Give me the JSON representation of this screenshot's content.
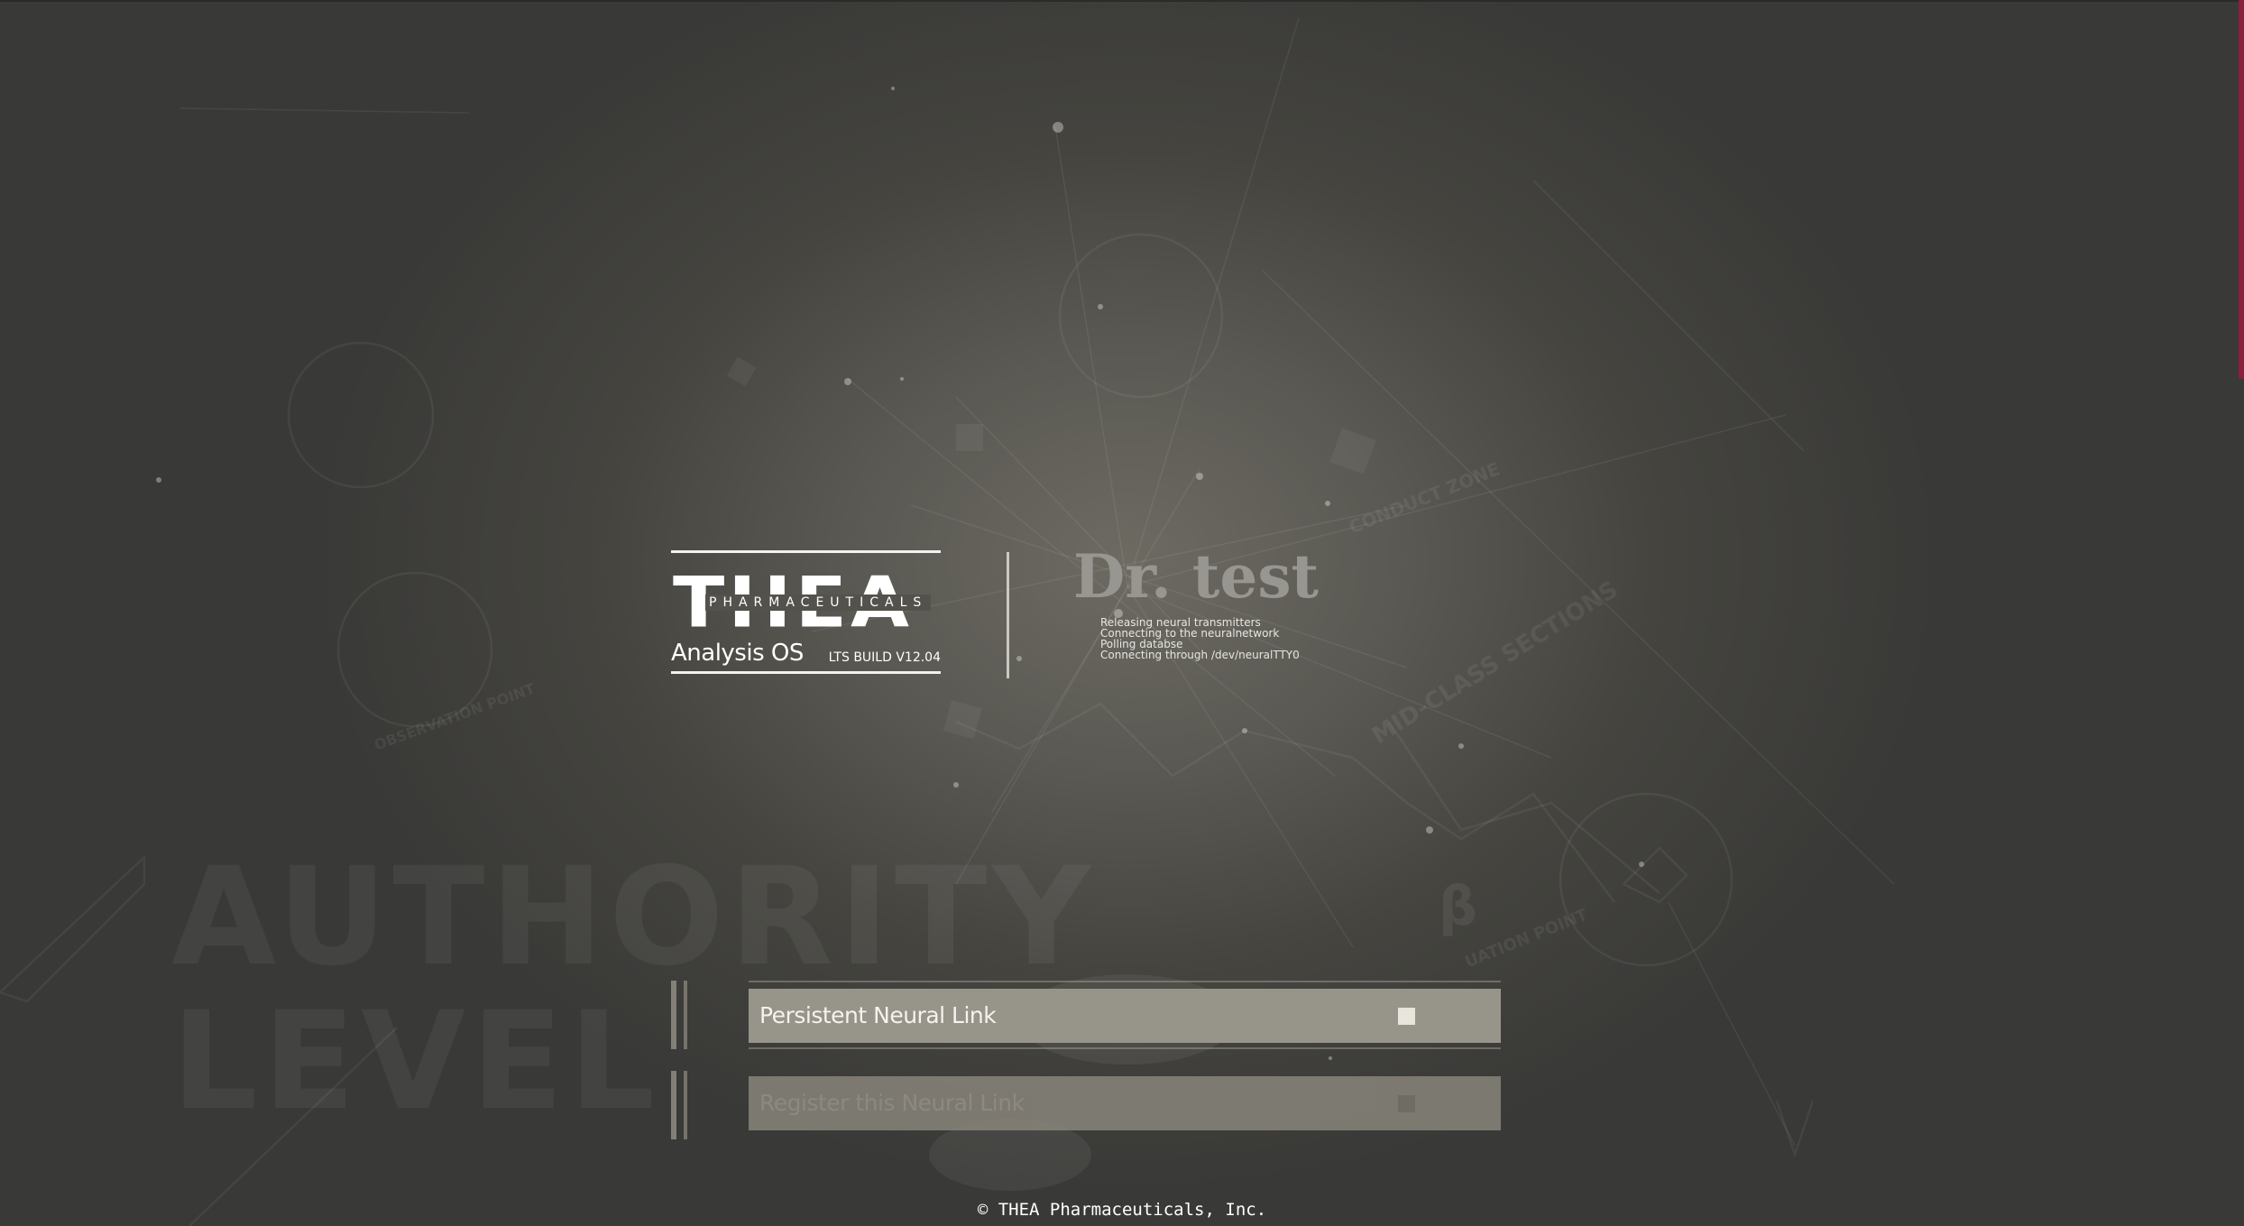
{
  "watermarks": {
    "line1": "AUTHORITY",
    "line2": "LEVEL",
    "small1": "CONDUCT ZONE",
    "small2": "MID-CLASS SECTIONS",
    "small3": "UATION POINT",
    "small4": "OBSERVATION POINT",
    "small5": "β"
  },
  "logo": {
    "wordmark": "THEA",
    "subtitle": "PHARMACEUTICALS",
    "product": "Analysis OS",
    "build": "LTS BUILD V12.04"
  },
  "user": {
    "title": "Dr. test",
    "status_lines": [
      "Releasing neural transmitters",
      "Connecting to the neuralnetwork",
      "Polling databse",
      "Connecting through /dev/neuralTTY0"
    ]
  },
  "options": [
    {
      "label": "Persistent Neural Link",
      "checked": true
    },
    {
      "label": "Register this Neural Link",
      "checked": false
    }
  ],
  "footer": {
    "copyright": "© THEA Pharmaceuticals, Inc."
  },
  "colors": {
    "background": "#4a4944",
    "button_active": "#97948a",
    "button_dim": "#8d897f",
    "text": "#ffffff"
  }
}
